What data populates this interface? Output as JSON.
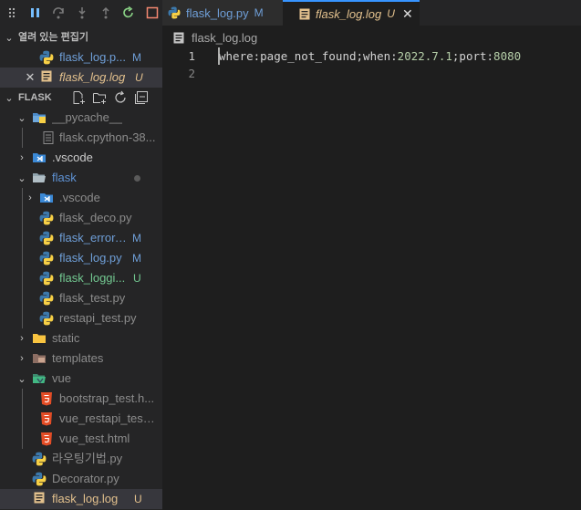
{
  "tabs": [
    {
      "label": "flask_log.py",
      "badge": "M"
    },
    {
      "label": "flask_log.log",
      "badge": "U"
    }
  ],
  "sidebar": {
    "open_editors_title": "열려 있는 편집기",
    "open_editors": [
      {
        "name": "flask_log.p...",
        "badge": "M"
      },
      {
        "name": "flask_log.log",
        "badge": "U"
      }
    ],
    "project_title": "FLASK",
    "tree": [
      {
        "name": "__pycache__"
      },
      {
        "name": "flask.cpython-38..."
      },
      {
        "name": ".vscode"
      },
      {
        "name": "flask"
      },
      {
        "name": ".vscode"
      },
      {
        "name": "flask_deco.py"
      },
      {
        "name": "flask_error....",
        "badge": "M"
      },
      {
        "name": "flask_log.py",
        "badge": "M"
      },
      {
        "name": "flask_loggi...",
        "badge": "U"
      },
      {
        "name": "flask_test.py"
      },
      {
        "name": "restapi_test.py"
      },
      {
        "name": "static"
      },
      {
        "name": "templates"
      },
      {
        "name": "vue"
      },
      {
        "name": "bootstrap_test.h..."
      },
      {
        "name": "vue_restapi_test...."
      },
      {
        "name": "vue_test.html"
      },
      {
        "name": "라우팅기법.py"
      },
      {
        "name": "Decorator.py"
      },
      {
        "name": "flask_log.log",
        "badge": "U"
      }
    ]
  },
  "editor": {
    "breadcrumb": "flask_log.log",
    "line_numbers": [
      "1",
      "2"
    ],
    "line1": {
      "t1": "where:page_not_found;when:",
      "date": "2022.7.1",
      "t2": ";port:",
      "port": "8080"
    }
  },
  "colors": {
    "modified": "#6f9fd8",
    "untracked": "#73c991",
    "accent": "#3794ff"
  }
}
